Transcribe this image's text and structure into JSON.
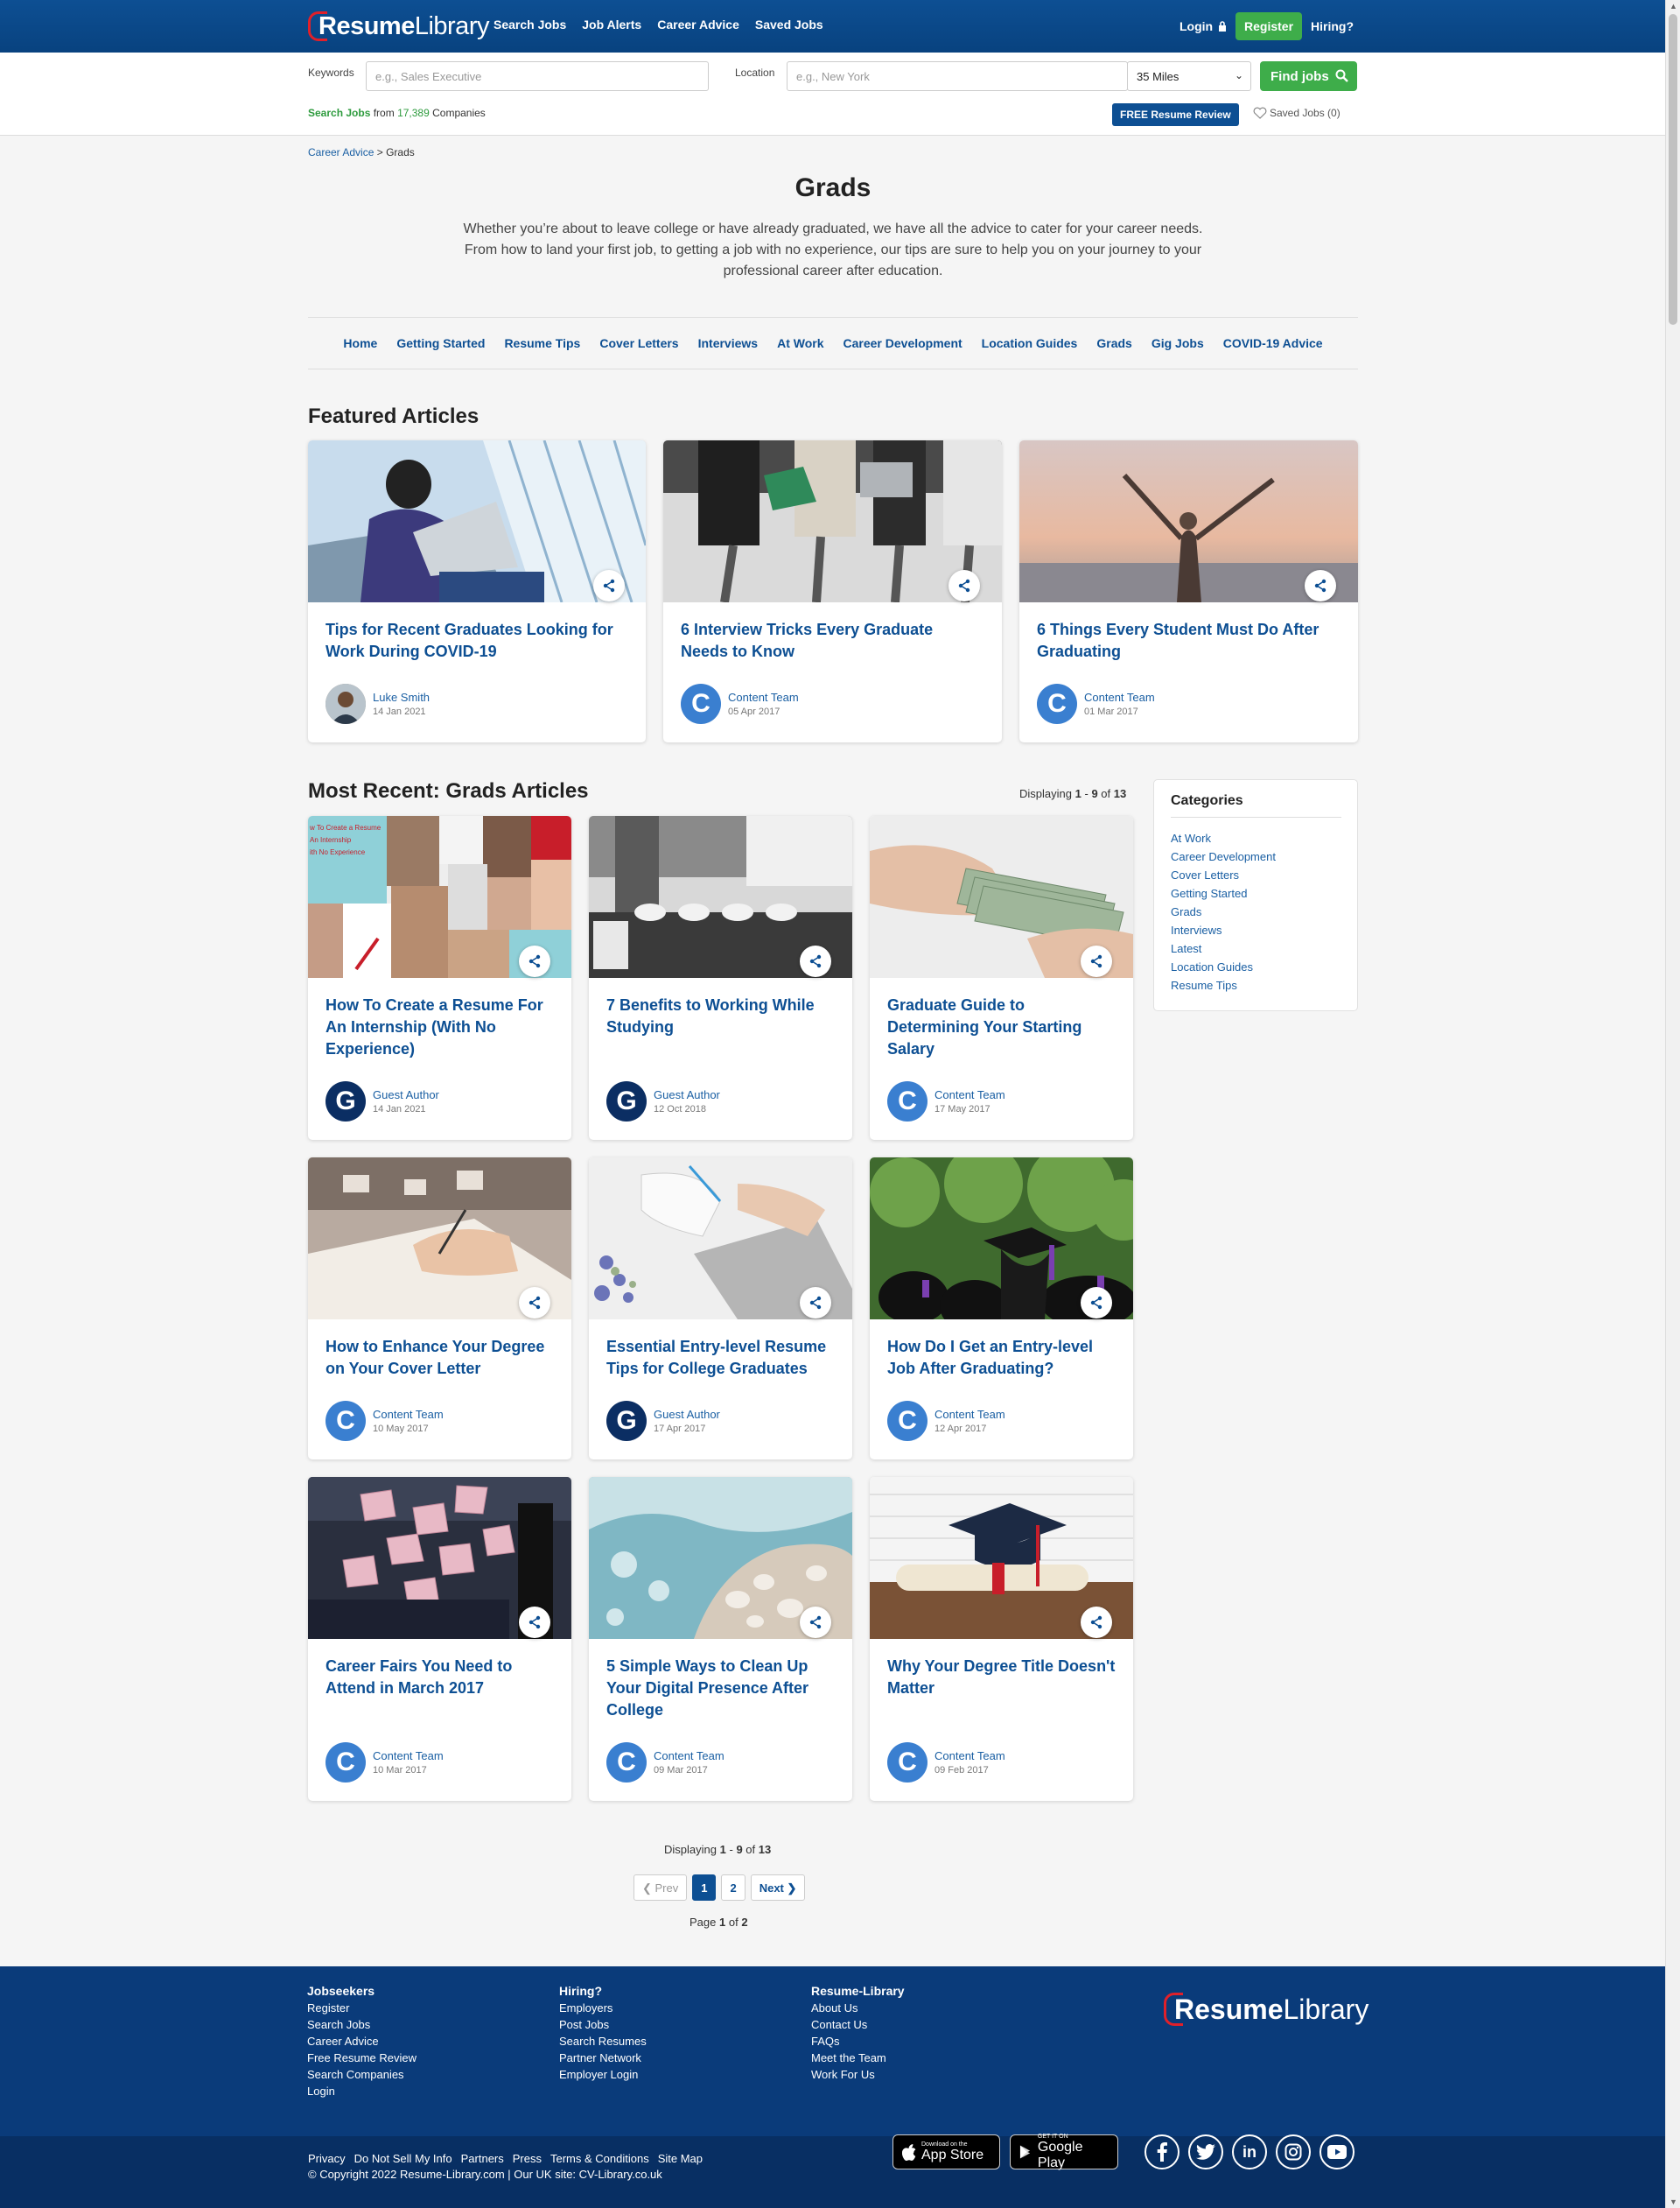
{
  "header": {
    "logo_bold": "Resume",
    "logo_light": "Library",
    "nav": [
      "Search Jobs",
      "Job Alerts",
      "Career Advice",
      "Saved Jobs"
    ],
    "login": "Login",
    "register": "Register",
    "hiring": "Hiring?"
  },
  "search": {
    "keywords_label": "Keywords",
    "keywords_placeholder": "e.g., Sales Executive",
    "location_label": "Location",
    "location_placeholder": "e.g., New York",
    "radius": "35 Miles",
    "find_button": "Find jobs",
    "stat_prefix": "Search Jobs",
    "stat_from": "from",
    "stat_count": "17,389",
    "stat_suffix": "Companies",
    "review_button": "FREE Resume Review",
    "saved_jobs": "Saved Jobs (0)"
  },
  "breadcrumb": {
    "parent": "Career Advice",
    "sep": ">",
    "current": "Grads"
  },
  "page": {
    "title": "Grads",
    "intro": "Whether you’re about to leave college or have already graduated, we have all the advice to cater for your career needs. From how to land your first job, to getting a job with no experience, our tips are sure to help you on your journey to your professional career after education."
  },
  "category_nav": [
    "Home",
    "Getting Started",
    "Resume Tips",
    "Cover Letters",
    "Interviews",
    "At Work",
    "Career Development",
    "Location Guides",
    "Grads",
    "Gig Jobs",
    "COVID-19 Advice"
  ],
  "featured": {
    "title": "Featured Articles",
    "articles": [
      {
        "title": "Tips for Recent Graduates Looking for Work During COVID-19",
        "author": "Luke Smith",
        "date": "14 Jan 2021",
        "avatar": "photo"
      },
      {
        "title": "6 Interview Tricks Every Graduate Needs to Know",
        "author": "Content Team",
        "date": "05 Apr 2017",
        "avatar": "C"
      },
      {
        "title": "6 Things Every Student Must Do After Graduating",
        "author": "Content Team",
        "date": "01 Mar 2017",
        "avatar": "C"
      }
    ]
  },
  "recent": {
    "title": "Most Recent: Grads Articles",
    "displaying": {
      "prefix": "Displaying",
      "from": "1",
      "dash": "-",
      "to": "9",
      "of": "of",
      "total": "13"
    },
    "articles": [
      {
        "title": "How To Create a Resume For An Internship (With No Experience)",
        "author": "Guest Author",
        "date": "14 Jan 2021",
        "avatar": "G"
      },
      {
        "title": "7 Benefits to Working While Studying",
        "author": "Guest Author",
        "date": "12 Oct 2018",
        "avatar": "G"
      },
      {
        "title": "Graduate Guide to Determining Your Starting Salary",
        "author": "Content Team",
        "date": "17 May 2017",
        "avatar": "C"
      },
      {
        "title": "How to Enhance Your Degree on Your Cover Letter",
        "author": "Content Team",
        "date": "10 May 2017",
        "avatar": "C"
      },
      {
        "title": "Essential Entry-level Resume Tips for College Graduates",
        "author": "Guest Author",
        "date": "17 Apr 2017",
        "avatar": "G"
      },
      {
        "title": "How Do I Get an Entry-level Job After Graduating?",
        "author": "Content Team",
        "date": "12 Apr 2017",
        "avatar": "C"
      },
      {
        "title": "Career Fairs You Need to Attend in March 2017",
        "author": "Content Team",
        "date": "10 Mar 2017",
        "avatar": "C"
      },
      {
        "title": "5 Simple Ways to Clean Up Your Digital Presence After College",
        "author": "Content Team",
        "date": "09 Mar 2017",
        "avatar": "C"
      },
      {
        "title": "Why Your Degree Title Doesn't Matter",
        "author": "Content Team",
        "date": "09 Feb 2017",
        "avatar": "C"
      }
    ],
    "thumb_text": [
      "w To Create a Resume",
      "An Internship",
      "ith No Experience"
    ]
  },
  "sidebar": {
    "title": "Categories",
    "items": [
      "At Work",
      "Career Development",
      "Cover Letters",
      "Getting Started",
      "Grads",
      "Interviews",
      "Latest",
      "Location Guides",
      "Resume Tips"
    ]
  },
  "pagination": {
    "prev": "❮ Prev",
    "pages": [
      "1",
      "2"
    ],
    "next": "Next ❯",
    "page_label": "Page",
    "current": "1",
    "of": "of",
    "total_pages": "2"
  },
  "footer": {
    "col1": {
      "title": "Jobseekers",
      "links": [
        "Register",
        "Search Jobs",
        "Career Advice",
        "Free Resume Review",
        "Search Companies",
        "Login"
      ]
    },
    "col2": {
      "title": "Hiring?",
      "links": [
        "Employers",
        "Post Jobs",
        "Search Resumes",
        "Partner Network",
        "Employer Login"
      ]
    },
    "col3": {
      "title": "Resume-Library",
      "links": [
        "About Us",
        "Contact Us",
        "FAQs",
        "Meet the Team",
        "Work For Us"
      ]
    },
    "bottom_links": [
      "Privacy",
      "Do Not Sell My Info",
      "Partners",
      "Press",
      "Terms & Conditions",
      "Site Map"
    ],
    "copyright": "© Copyright 2022 Resume-Library.com | Our UK site: CV-Library.co.uk",
    "app_store_small": "Download on the",
    "app_store": "App Store",
    "play_small": "GET IT ON",
    "play": "Google Play",
    "social": [
      "facebook-icon",
      "twitter-icon",
      "linkedin-icon",
      "instagram-icon",
      "youtube-icon"
    ]
  },
  "colors": {
    "brand_blue": "#0d4f93",
    "green": "#3ead4a",
    "red": "#e0202a",
    "footer": "#0a3b7a"
  }
}
